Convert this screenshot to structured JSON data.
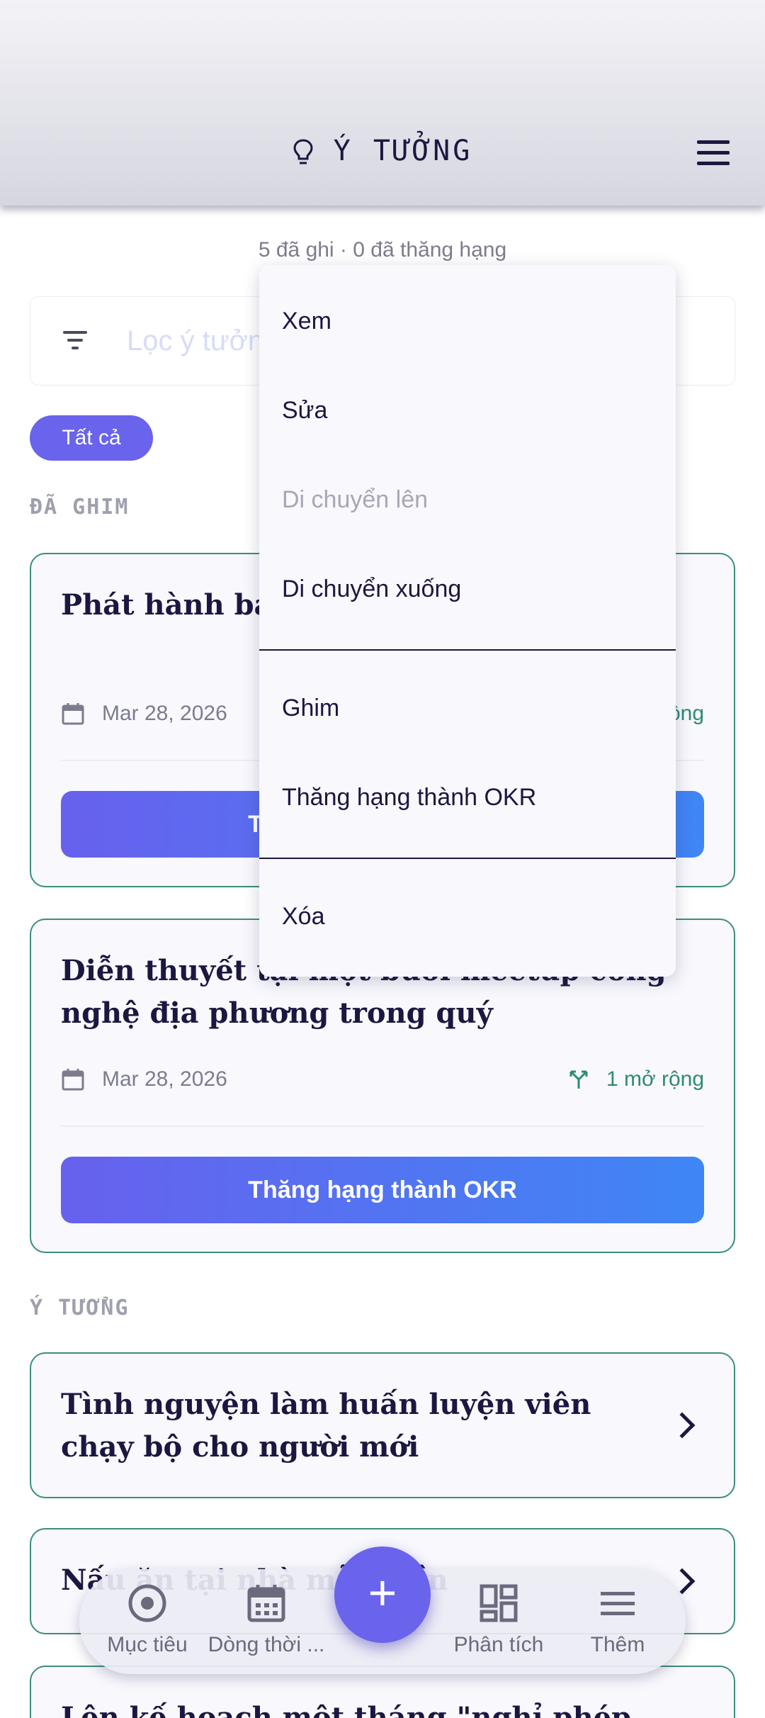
{
  "header": {
    "title": "Ý TƯỞNG"
  },
  "summary": "5 đã ghi · 0 đã thăng hạng",
  "filter": {
    "placeholder": "Lọc ý tưởng"
  },
  "chip": {
    "label": "Tất cả"
  },
  "sections": {
    "pinned": "ĐÃ GHIM",
    "ideas": "Ý TƯỞNG"
  },
  "pinned_cards": [
    {
      "title": "Phát hành bản MVP cho dự án SaaS",
      "date": "Mar 28, 2026",
      "expansions": "1 mở rộng",
      "button": "Thăng hạng thành OKR"
    },
    {
      "title": "Diễn thuyết tại một buổi meetup công nghệ địa phương trong quý",
      "date": "Mar 28, 2026",
      "expansions": "1 mở rộng",
      "button": "Thăng hạng thành OKR"
    }
  ],
  "idea_cards": [
    {
      "title": "Tình nguyện làm huấn luyện viên chạy bộ cho người mới"
    },
    {
      "title": "Nấu ăn tại nhà mỗi tuần"
    },
    {
      "title": "Lên kế hoạch một tháng \"nghỉ phép kỹ thuật số\""
    }
  ],
  "context_menu": {
    "items": [
      {
        "label": "Xem",
        "enabled": true
      },
      {
        "label": "Sửa",
        "enabled": true
      },
      {
        "label": "Di chuyển lên",
        "enabled": false
      },
      {
        "label": "Di chuyển xuống",
        "enabled": true
      },
      {
        "label": "Ghim",
        "enabled": true
      },
      {
        "label": "Thăng hạng thành OKR",
        "enabled": true
      },
      {
        "label": "Xóa",
        "enabled": true
      }
    ]
  },
  "bottom_nav": {
    "items": [
      {
        "label": "Mục tiêu",
        "icon": "target-icon"
      },
      {
        "label": "Dòng thời ...",
        "icon": "calendar-icon"
      },
      {
        "label": "Phân tích",
        "icon": "dashboard-icon"
      },
      {
        "label": "Thêm",
        "icon": "menu-icon"
      }
    ],
    "fab": "+"
  },
  "colors": {
    "accent": "#6a63ec",
    "accent_end": "#3f86f5",
    "card_border": "#3b8e7d",
    "text": "#1b1740"
  }
}
